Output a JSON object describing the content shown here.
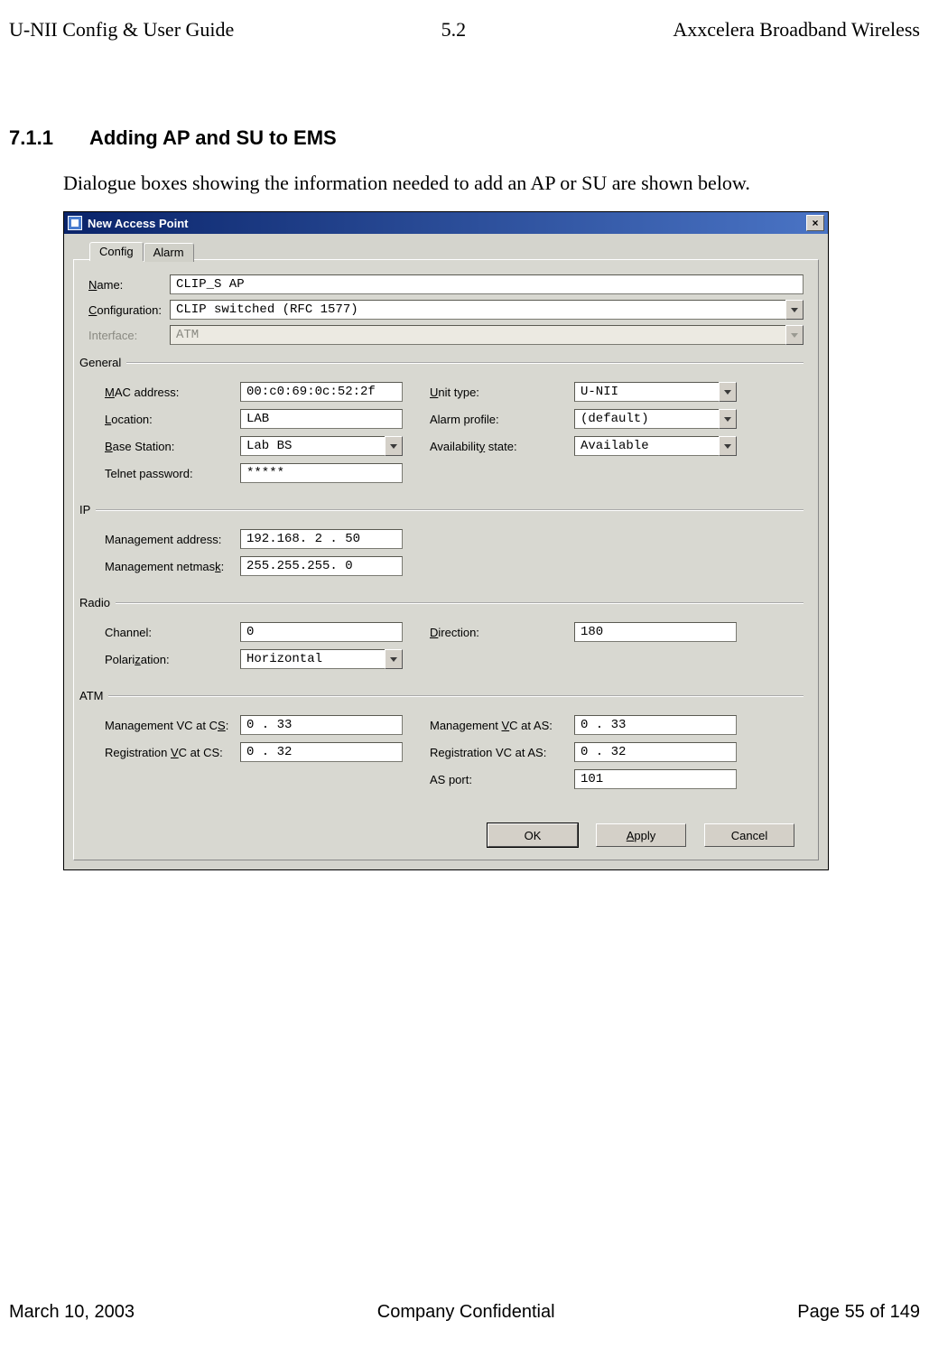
{
  "header": {
    "left": "U-NII Config & User Guide",
    "center": "5.2",
    "right": "Axxcelera Broadband Wireless"
  },
  "section": {
    "number": "7.1.1",
    "title": "Adding AP and SU to EMS",
    "intro": "Dialogue boxes showing the information needed to add an AP or SU are shown below."
  },
  "dialog": {
    "title": "New Access Point",
    "close_glyph": "×",
    "tabs": {
      "config": "Config",
      "alarm": "Alarm"
    },
    "top": {
      "name_label": "Name:",
      "name_value": "CLIP_S AP",
      "config_label": "Configuration:",
      "config_value": "CLIP switched (RFC 1577)",
      "interface_label": "Interface:",
      "interface_value": "ATM"
    },
    "general": {
      "title": "General",
      "mac_label": "MAC address:",
      "mac_value": "00:c0:69:0c:52:2f",
      "unit_type_label": "Unit type:",
      "unit_type_value": "U-NII",
      "location_label": "Location:",
      "location_value": "LAB",
      "alarm_profile_label": "Alarm profile:",
      "alarm_profile_value": "(default)",
      "base_station_label": "Base Station:",
      "base_station_value": "Lab BS",
      "availability_label": "Availability state:",
      "availability_value": "Available",
      "telnet_label": "Telnet password:",
      "telnet_value": "*****"
    },
    "ip": {
      "title": "IP",
      "mgmt_addr_label": "Management address:",
      "mgmt_addr_value": "192.168. 2 . 50",
      "mgmt_mask_label": "Management netmask:",
      "mgmt_mask_value": "255.255.255. 0"
    },
    "radio": {
      "title": "Radio",
      "channel_label": "Channel:",
      "channel_value": "0",
      "direction_label": "Direction:",
      "direction_value": "180",
      "polarization_label": "Polarization:",
      "polarization_value": "Horizontal"
    },
    "atm": {
      "title": "ATM",
      "mgmt_vc_cs_label": "Management VC at CS:",
      "mgmt_vc_cs_value": " 0  .  33",
      "mgmt_vc_as_label": "Management VC at AS:",
      "mgmt_vc_as_value": " 0  .  33",
      "reg_vc_cs_label": "Registration VC at CS:",
      "reg_vc_cs_value": " 0  .  32",
      "reg_vc_as_label": "Registration VC at AS:",
      "reg_vc_as_value": " 0  .  32",
      "as_port_label": "AS port:",
      "as_port_value": "101"
    },
    "buttons": {
      "ok": "OK",
      "apply": "Apply",
      "cancel": "Cancel"
    }
  },
  "footer": {
    "left": "March 10, 2003",
    "center": "Company Confidential",
    "right": "Page 55 of 149"
  }
}
